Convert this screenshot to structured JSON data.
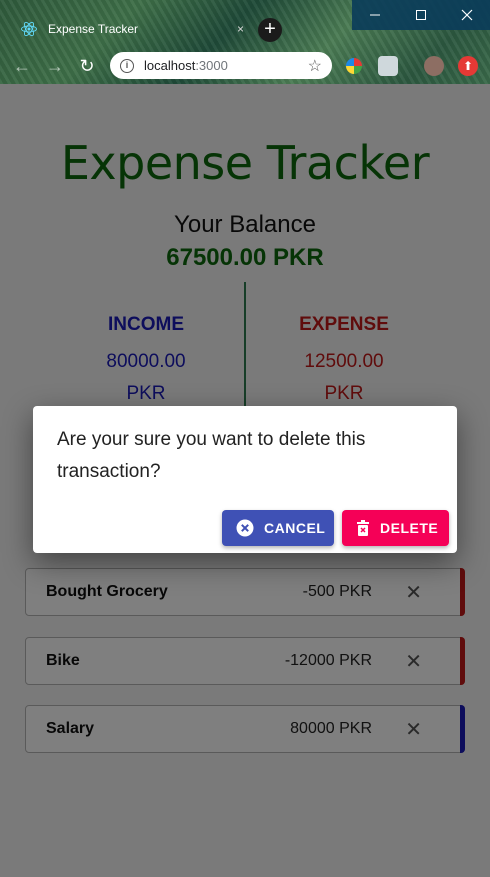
{
  "browser": {
    "tab_title": "Expense Tracker",
    "tab_close": "×",
    "new_tab": "+",
    "url_host": "localhost",
    "url_port": ":3000",
    "window_controls": {
      "minimize": "—",
      "maximize": "☐",
      "close": "✕"
    },
    "nav": {
      "back": "←",
      "forward": "→",
      "reload": "↻"
    },
    "star": "☆"
  },
  "app": {
    "title": "Expense Tracker",
    "balance_label": "Your Balance",
    "balance_value": "67500.00 PKR",
    "income": {
      "label": "INCOME",
      "amount": "80000.00",
      "currency": "PKR"
    },
    "expense": {
      "label": "EXPENSE",
      "amount": "12500.00",
      "currency": "PKR"
    },
    "transactions": [
      {
        "name": "Bought Grocery",
        "amount": "-500 PKR",
        "type": "expense"
      },
      {
        "name": "Bike",
        "amount": "-12000 PKR",
        "type": "expense"
      },
      {
        "name": "Salary",
        "amount": "80000 PKR",
        "type": "income"
      }
    ],
    "remove_glyph": "✕"
  },
  "dialog": {
    "message": "Are your sure you want to delete this transaction?",
    "cancel_label": "CANCEL",
    "delete_label": "DELETE"
  },
  "colors": {
    "title_green": "#0c690c",
    "income_blue": "#1a1ab8",
    "expense_red": "#c01818",
    "cancel_button": "#3f51b5",
    "delete_button": "#f50057"
  }
}
